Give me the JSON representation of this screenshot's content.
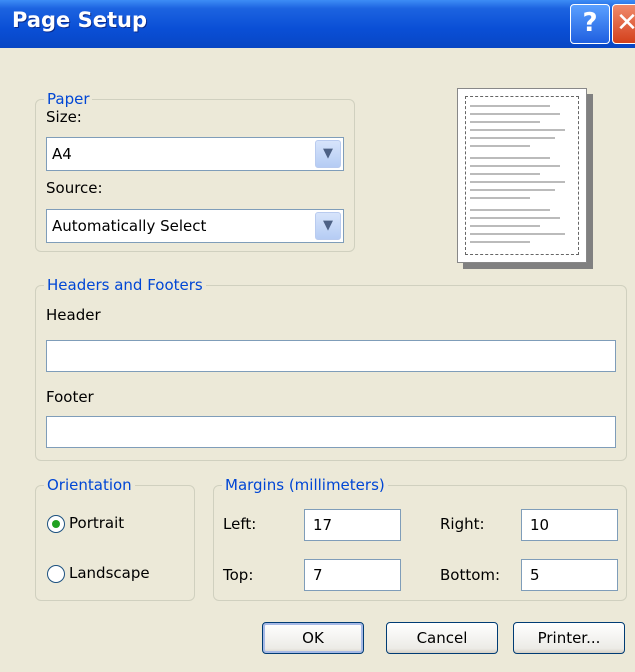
{
  "window": {
    "title": "Page Setup",
    "help_glyph": "?",
    "close_glyph": "✕"
  },
  "paper": {
    "legend": "Paper",
    "size_label": "Size:",
    "size_value": "A4",
    "source_label": "Source:",
    "source_value": "Automatically Select"
  },
  "headers_footers": {
    "legend": "Headers and Footers",
    "header_label": "Header",
    "header_value": "",
    "footer_label": "Footer",
    "footer_value": ""
  },
  "orientation": {
    "legend": "Orientation",
    "portrait_label": "Portrait",
    "landscape_label": "Landscape",
    "selected": "Portrait"
  },
  "margins": {
    "legend": "Margins (millimeters)",
    "left_label": "Left:",
    "left_value": "17",
    "right_label": "Right:",
    "right_value": "10",
    "top_label": "Top:",
    "top_value": "7",
    "bottom_label": "Bottom:",
    "bottom_value": "5"
  },
  "buttons": {
    "ok": "OK",
    "cancel": "Cancel",
    "printer": "Printer..."
  },
  "icons": {
    "dropdown": "chevron-down-icon"
  }
}
